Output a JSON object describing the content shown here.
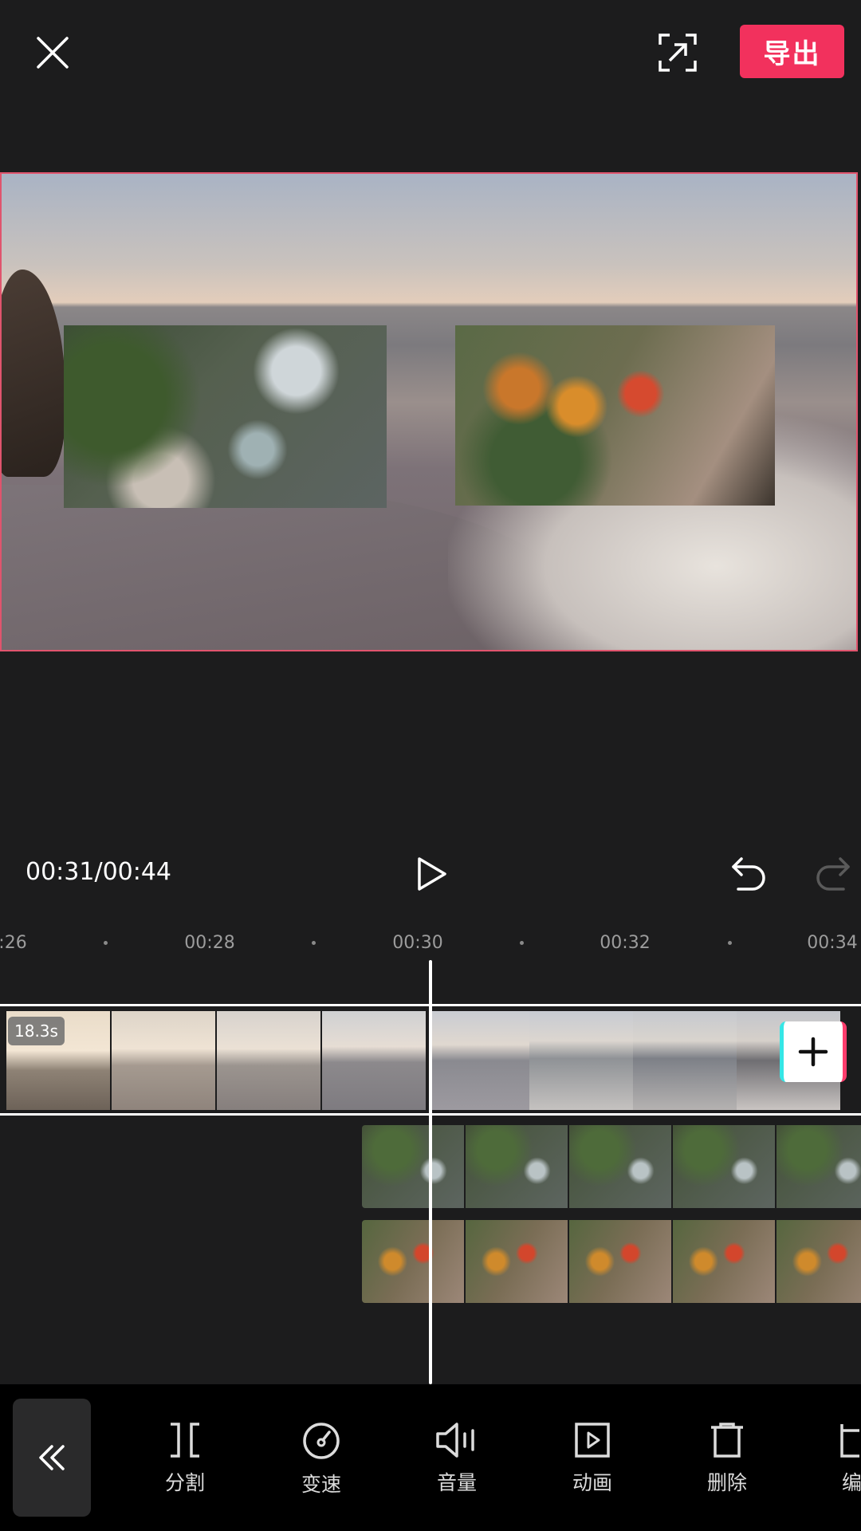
{
  "topbar": {
    "close_icon": "close-icon",
    "fullscreen_icon": "fullscreen-icon",
    "export_label": "导出",
    "accent_color": "#f2315d"
  },
  "player": {
    "timecode": "00:31/00:44"
  },
  "ruler": {
    "labels": [
      ":26",
      "00:28",
      "00:30",
      "00:32",
      "00:34"
    ]
  },
  "main_track": {
    "duration_badge": "18.3s"
  },
  "toolbar": {
    "tools": [
      {
        "label": "分割",
        "icon": "split-icon"
      },
      {
        "label": "变速",
        "icon": "speed-icon"
      },
      {
        "label": "音量",
        "icon": "volume-icon"
      },
      {
        "label": "动画",
        "icon": "animation-icon"
      },
      {
        "label": "删除",
        "icon": "delete-icon"
      },
      {
        "label": "编",
        "icon": "edit-icon"
      }
    ]
  }
}
